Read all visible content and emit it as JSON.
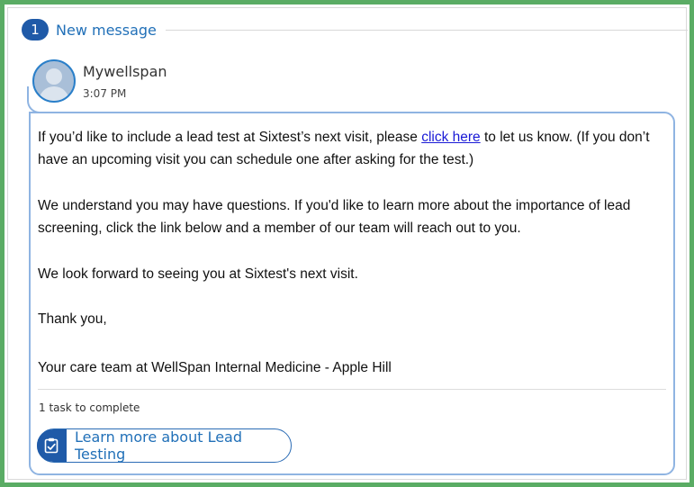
{
  "header": {
    "new_count": "1",
    "new_label": "New message"
  },
  "sender": {
    "name": "Mywellspan",
    "time": "3:07 PM"
  },
  "message": {
    "p1_before": "If you’d like to include a lead test at Sixtest’s next visit, please ",
    "p1_link": "click here",
    "p1_after": " to let us know. (If you don’t have an upcoming visit you can schedule one after asking for the test.)",
    "p2": "We understand you may have questions. If you'd like to learn more about the importance of lead screening, click the link below and a member of our team will reach out to you.",
    "p3": "We look forward to seeing you at Sixtest's next visit.",
    "p4": "Thank you,",
    "p5": "Your care team at WellSpan Internal Medicine - Apple Hill"
  },
  "tasks": {
    "count_label": "1 task to complete",
    "button_label": "Learn more about Lead Testing",
    "button_icon": "clipboard-check-icon"
  },
  "colors": {
    "frame_green": "#5aac64",
    "brand_blue": "#1f5aa8",
    "link_blue": "#1a1ad6",
    "bubble_border": "#8fb4e2"
  }
}
